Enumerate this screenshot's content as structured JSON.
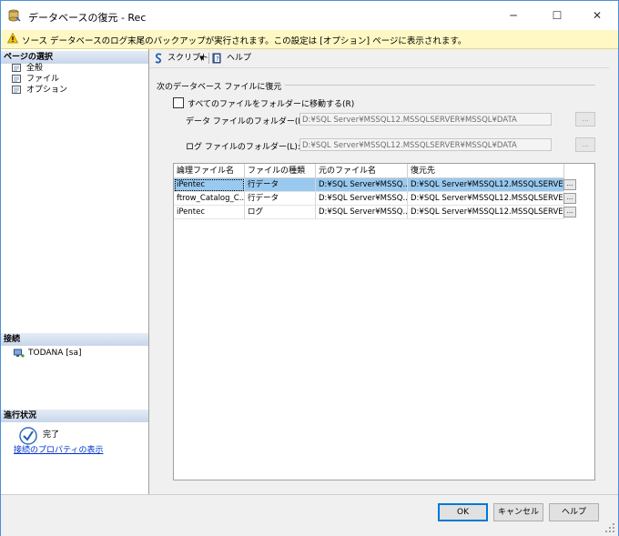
{
  "window": {
    "title": "データベースの復元 - Rec",
    "minimize": "─",
    "maximize": "☐",
    "close": "✕"
  },
  "warning": {
    "text": "ソース データベースのログ末尾のバックアップが実行されます。この設定は [オプション] ページに表示されます。"
  },
  "left_panel": {
    "page_select_header": "ページの選択",
    "pages": [
      {
        "label": "全般"
      },
      {
        "label": "ファイル"
      },
      {
        "label": "オプション"
      }
    ],
    "connection_header": "接続",
    "connection_name": "TODANA [sa]",
    "connection_props_link": "接続のプロパティの表示",
    "progress_header": "進行状況",
    "progress_status": "完了"
  },
  "toolbar": {
    "script_label": "スクリプト",
    "help_label": "ヘルプ"
  },
  "restore_group": {
    "label": "次のデータベース ファイルに復元",
    "move_all_label": "すべてのファイルをフォルダーに移動する(R)",
    "data_folder_label": "データ ファイルのフォルダー(D):",
    "data_folder_value": "D:¥SQL Server¥MSSQL12.MSSQLSERVER¥MSSQL¥DATA",
    "log_folder_label": "ログ ファイルのフォルダー(L):",
    "log_folder_value": "D:¥SQL Server¥MSSQL12.MSSQLSERVER¥MSSQL¥DATA",
    "browse": "..."
  },
  "file_table": {
    "columns": [
      "論理ファイル名",
      "ファイルの種類",
      "元のファイル名",
      "復元先"
    ],
    "rows": [
      {
        "logical": "iPentec",
        "type": "行データ",
        "original": "D:¥SQL Server¥MSSQ...",
        "restore_as": "D:¥SQL Server¥MSSQL12.MSSQLSERVE...",
        "btn": "..."
      },
      {
        "logical": "ftrow_Catalog_C...",
        "type": "行データ",
        "original": "D:¥SQL Server¥MSSQ...",
        "restore_as": "D:¥SQL Server¥MSSQL12.MSSQLSERVE...",
        "btn": "..."
      },
      {
        "logical": "iPentec",
        "type": "ログ",
        "original": "D:¥SQL Server¥MSSQ...",
        "restore_as": "D:¥SQL Server¥MSSQL12.MSSQLSERVE...",
        "btn": "..."
      }
    ]
  },
  "buttons": {
    "ok": "OK",
    "cancel": "キャンセル",
    "help": "ヘルプ"
  }
}
